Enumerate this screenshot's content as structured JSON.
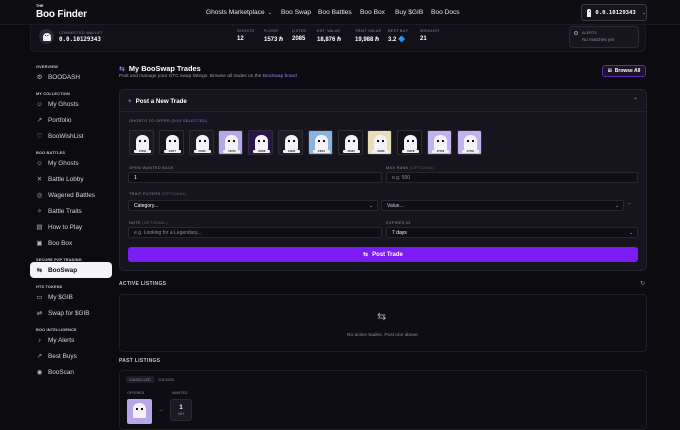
{
  "brand": {
    "the": "THE",
    "name": "Boo Finder"
  },
  "nav": {
    "marketplace": "Ghosts Marketplace",
    "swap": "Boo Swap",
    "battles": "Boo Battles",
    "box": "Boo Box",
    "buy": "Buy $GIB",
    "docs": "Boo Docs"
  },
  "wallet": {
    "address": "0.0.10129343"
  },
  "stats": {
    "connected_label": "CONNECTED WALLET",
    "address": "0.0.10129343",
    "items": [
      {
        "k": "GHOSTS",
        "v": "12"
      },
      {
        "k": "FLOOR",
        "v": "1573 ℏ"
      },
      {
        "k": "LISTED",
        "v": "2085"
      },
      {
        "k": "EST. VALUE",
        "v": "18,876 ℏ"
      },
      {
        "k": "TRAIT VALUE",
        "v": "19,988 ℏ"
      },
      {
        "k": "BEST BUY",
        "v": "3.2 🔷"
      },
      {
        "k": "WISHLIST",
        "v": "21"
      }
    ],
    "alerts_label": "ALERTS",
    "alerts_value": "No matches yet"
  },
  "sidebar": {
    "overview": "OVERVIEW",
    "boodash": "BOODASH",
    "my_collection": "MY COLLECTION",
    "my_ghosts": "My Ghosts",
    "portfolio": "Portfolio",
    "wishlist": "BooWishList",
    "boo_battles": "BOO BATTLES",
    "b_my_ghosts": "My Ghosts",
    "battle_lobby": "Battle Lobby",
    "wagered": "Wagered Battles",
    "traits": "Battle Traits",
    "how_to": "How to Play",
    "boo_box": "Boo Box",
    "secure": "SECURE P2P TRADING",
    "booswap": "BooSwap",
    "hts": "HTS TOKENS",
    "my_gib": "My $GIB",
    "swap_gib": "Swap for $GIB",
    "intel": "BOO INTELLIGENCE",
    "alerts": "My Alerts",
    "best_buys": "Best Buys",
    "booscan": "BooScan"
  },
  "main": {
    "title": "My BooSwap Trades",
    "subtitle_pre": "Post and manage your OTC swap listings. Browse all trades on the ",
    "subtitle_link": "BooSwap board",
    "browse": "Browse All",
    "card_title": "Post a New Trade",
    "ghosts_label": "GHOSTS TO OFFER",
    "ghosts_selected": "(0/10 SELECTED)",
    "ghost_tags": [
      "#7052",
      "#4077",
      "#7952",
      "#4073",
      "#6038",
      "#4029",
      "#4016",
      "#4025",
      "#4060",
      "#4978",
      "#7728",
      "#7153"
    ],
    "open_wanted_label": "OPEN WANTED BACK",
    "open_wanted_value": "1",
    "max_rank_label": "MAX RANK",
    "max_rank_opt": "(OPTIONAL)",
    "max_rank_ph": "e.g. 500",
    "trait_label": "TRAIT FILTERS",
    "trait_opt": "(OPTIONAL)",
    "category": "Category...",
    "value": "Value...",
    "note_label": "NOTE",
    "note_opt": "(OPTIONAL)",
    "note_ph": "e.g. Looking for a Legendary...",
    "expires_label": "EXPIRES IN",
    "expires_value": "7 days",
    "post": "Post Trade",
    "active": "ACTIVE LISTINGS",
    "empty": "No active trades. Post one above.",
    "past": "PAST LISTINGS",
    "past_tab1": "CANCELLED",
    "past_tab2": "1/11/2025",
    "offered": "OFFERED",
    "wanted": "WANTED",
    "wanted_n": "1",
    "wanted_u": "ANY"
  },
  "colors": {
    "accent": "#7c1cf4",
    "link": "#a77bff"
  }
}
